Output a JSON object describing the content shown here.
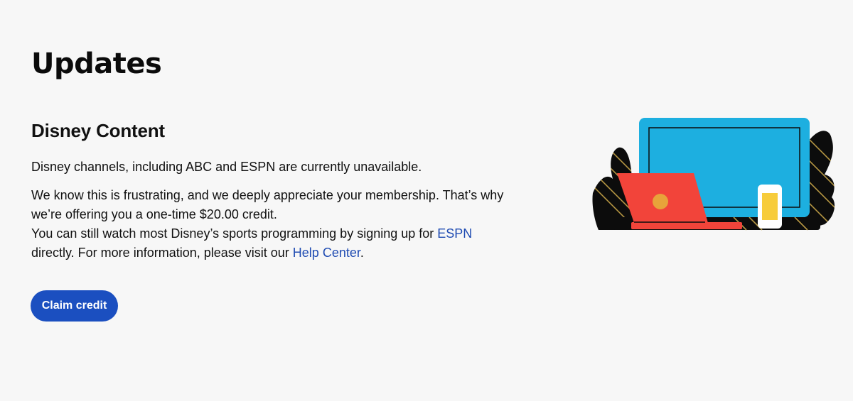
{
  "page": {
    "title": "Updates"
  },
  "notice": {
    "heading": "Disney Content",
    "availability_text": "Disney channels, including ABC and ESPN are currently unavailable.",
    "credit_text_line1": "We know this is frustrating, and we deeply appreciate your membership. That’s why",
    "credit_text_line2": "we’re offering you a one-time $20.00 credit.",
    "sports_text_before_link": "You can still watch most Disney’s sports programming by signing up for ",
    "espn_link_label": "ESPN",
    "sports_text_after_link": "directly. For more information, please visit our ",
    "help_center_link_label": "Help Center",
    "sports_text_end": "."
  },
  "actions": {
    "claim_credit_label": "Claim credit"
  },
  "illustration": {
    "icon": "tv-laptop-phone-illustration",
    "colors": {
      "tv_screen": "#1dafe0",
      "laptop": "#f2443a",
      "laptop_dot": "#e8a33a",
      "phone_screen": "#f7cc3b",
      "bush": "#0c0c0c",
      "bush_stripes": "#c9a64a"
    }
  },
  "colors": {
    "background": "#f7f7f7",
    "accent": "#1b4fc0",
    "link": "#1f4bb2",
    "text": "#111111"
  }
}
